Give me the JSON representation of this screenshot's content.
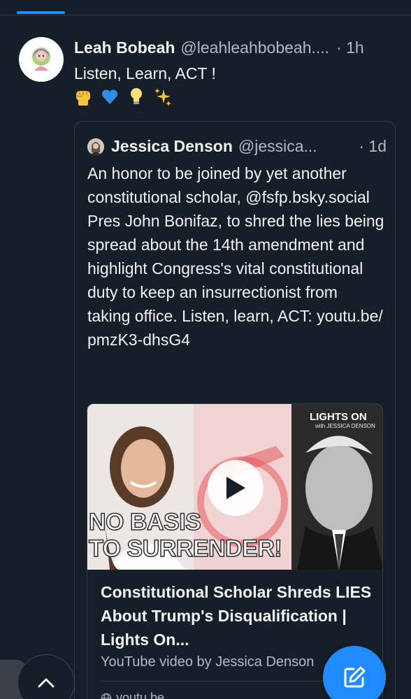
{
  "post": {
    "display_name": "Leah Bobeah",
    "handle": "@leahleahbobeah....",
    "time": "· 1h",
    "text": "Listen, Learn, ACT !",
    "emojis": [
      "raised-fist",
      "blue-heart",
      "light-bulb",
      "sparkles"
    ]
  },
  "quote": {
    "display_name": "Jessica Denson",
    "handle": "@jessica...",
    "time": "· 1d",
    "text": "An honor to be joined by yet another constitutional scholar, @fsfp.bsky.social Pres John Bonifaz, to shred the lies being spread about the 14th amendment and highlight Congress's vital constitutional duty to keep an insurrectionist from taking office. Listen, learn, ACT: youtu.be/ pmzK3-dhsG4",
    "embed": {
      "thumbnail_overlay_line1": "NO BASIS",
      "thumbnail_overlay_line2": "TO SURRENDER!",
      "logo_text": "LIGHTS ON",
      "logo_subtext": "with JESSICA DENSON",
      "title": "Constitutional Scholar Shreds LIES About Trump's Disqualification  |  Lights On...",
      "description": "YouTube video by Jessica Denson",
      "domain": "youtu.be"
    }
  },
  "colors": {
    "background": "#161e27",
    "accent": "#208bfe",
    "muted_text": "#aebbc9",
    "border": "#2e3a48"
  }
}
